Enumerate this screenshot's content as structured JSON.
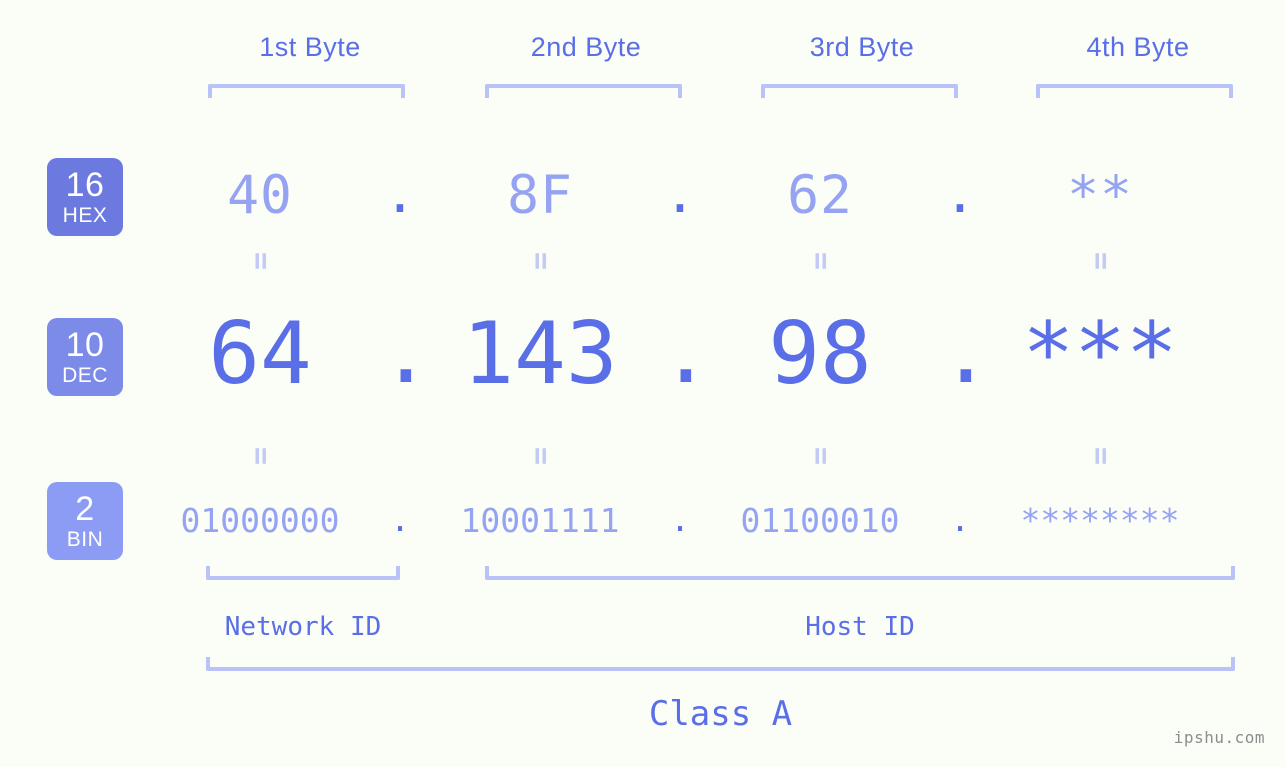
{
  "background_color": "#fbfdf7",
  "accent_color": "#5a6ee8",
  "accent_light_color": "#95a3f2",
  "bracket_color": "#b9c3fa",
  "header": {
    "bytes": [
      {
        "label": "1st Byte"
      },
      {
        "label": "2nd Byte"
      },
      {
        "label": "3rd Byte"
      },
      {
        "label": "4th Byte"
      }
    ]
  },
  "bases": [
    {
      "number": "16",
      "name": "HEX",
      "color": "#6c7ae0"
    },
    {
      "number": "10",
      "name": "DEC",
      "color": "#7c8ae8"
    },
    {
      "number": "2",
      "name": "BIN",
      "color": "#8c9cf5"
    }
  ],
  "rows": {
    "hex": {
      "base_number": "16",
      "base_name": "HEX",
      "values": [
        "40",
        "8F",
        "62",
        "**"
      ],
      "separator": "."
    },
    "dec": {
      "base_number": "10",
      "base_name": "DEC",
      "values": [
        "64",
        "143",
        "98",
        "***"
      ],
      "separator": "."
    },
    "bin": {
      "base_number": "2",
      "base_name": "BIN",
      "values": [
        "01000000",
        "10001111",
        "01100010",
        "********"
      ],
      "separator": "."
    }
  },
  "equals_symbol": "=",
  "sections": {
    "network_id": "Network ID",
    "host_id": "Host ID",
    "class": "Class A"
  },
  "watermark": "ipshu.com"
}
